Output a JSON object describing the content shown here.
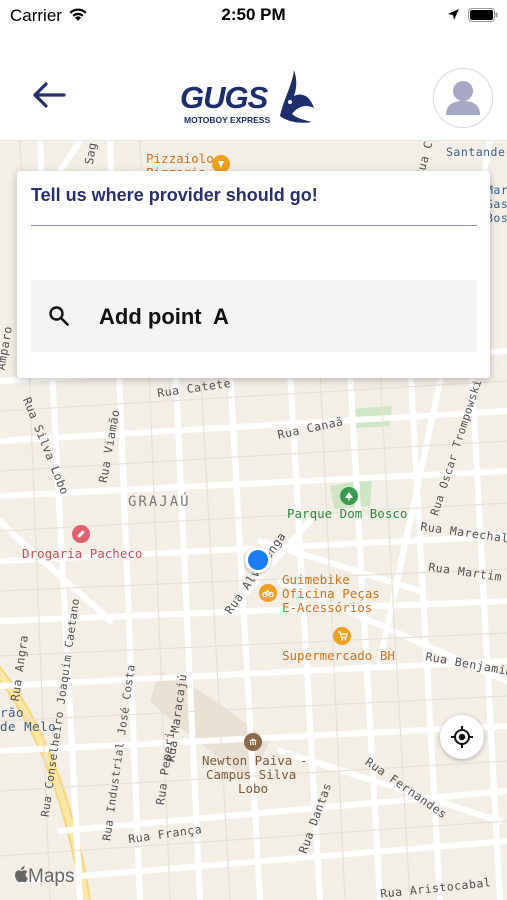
{
  "status_bar": {
    "carrier": "Carrier",
    "time": "2:50 PM"
  },
  "header": {
    "logo_text": "GUGS",
    "logo_subtitle": "MOTOBOY EXPRESS",
    "brand_color": "#1e2d6b"
  },
  "route_card": {
    "title": "Tell us where provider should go!",
    "add_point_label": "Add point  A"
  },
  "map": {
    "neighborhood": "GRAJAÚ",
    "streets": [
      "Rua Catete",
      "Rua Canaã",
      "Rua Oscar Trompowski",
      "Rua Marechal Bi",
      "Rua Martim Fra",
      "Rua Benjamim",
      "Rua Alvarenga",
      "Rua Viamão",
      "Rua Silva Lobo",
      "Rua Angra",
      "Rua Conselheiro Joaquim Caetano",
      "Rua Industrial José Costa",
      "Rua Maracajú",
      "Rua Peperi",
      "Rua França",
      "Rua Dantas",
      "Rua Fernandes",
      "Amparo",
      "Rua Sag",
      "Rua Che",
      "Rua Aristocabal",
      "Santande",
      "Mar",
      "Gas",
      "Bos",
      "rão",
      "de Melo"
    ],
    "pois": {
      "pizzaiolo": "Pizzaiolo",
      "pizzaiolo_second_line": "Pizzaria",
      "parque": "Parque Dom Bosco",
      "drogaria": "Drogaria Pacheco",
      "guimebike_line1": "Guimebike",
      "guimebike_line2": "Oficina Peças",
      "guimebike_line3": "E-Acessórios",
      "supermercado": "Supermercado BH",
      "newton_line1": "Newton Paiva -",
      "newton_line2": "Campus Silva",
      "newton_line3": "Lobo"
    },
    "attribution": "Maps",
    "colors": {
      "user_location": "#1a7cf2",
      "park": "#3a9a4f",
      "shop": "#f0a020",
      "pharmacy": "#e06070",
      "university": "#8a6a4a"
    }
  }
}
